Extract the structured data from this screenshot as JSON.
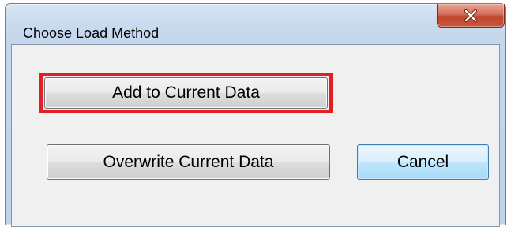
{
  "dialog": {
    "title": "Choose Load Method",
    "close_icon": "close-icon",
    "close_button_color": "#c9563e"
  },
  "buttons": {
    "add_label": "Add to Current Data",
    "overwrite_label": "Overwrite Current Data",
    "cancel_label": "Cancel"
  },
  "annotation": {
    "highlight_color": "#e31e24",
    "highlighted_button": "Add to Current Data"
  }
}
